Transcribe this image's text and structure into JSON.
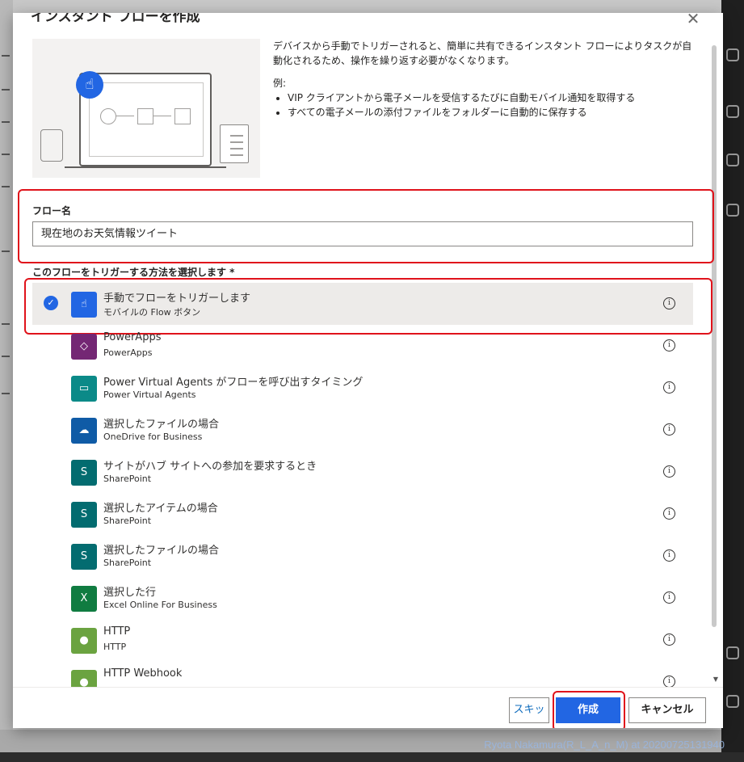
{
  "dialog": {
    "title": "インスタント フローを作成",
    "description": "デバイスから手動でトリガーされると、簡単に共有できるインスタント フローによりタスクが自動化されるため、操作を繰り返す必要がなくなります。",
    "example_label": "例:",
    "examples": [
      "VIP クライアントから電子メールを受信するたびに自動モバイル通知を取得する",
      "すべての電子メールの添付ファイルをフォルダーに自動的に保存する"
    ]
  },
  "flow_name": {
    "label": "フロー名",
    "value": "現在地のお天気情報ツイート"
  },
  "trigger_section": {
    "label": "このフローをトリガーする方法を選択します *"
  },
  "triggers": [
    {
      "name": "手動でフローをトリガーします",
      "sub": "モバイルの Flow ボタン",
      "color": "#2266e3",
      "icon": "☝",
      "selected": true
    },
    {
      "name": "PowerApps",
      "sub": "PowerApps",
      "color": "#742774",
      "icon": "◇"
    },
    {
      "name": "Power Virtual Agents がフローを呼び出すタイミング",
      "sub": "Power Virtual Agents",
      "color": "#0b8a88",
      "icon": "▭"
    },
    {
      "name": "選択したファイルの場合",
      "sub": "OneDrive for Business",
      "color": "#0f5ba6",
      "icon": "☁"
    },
    {
      "name": "サイトがハブ サイトへの参加を要求するとき",
      "sub": "SharePoint",
      "color": "#036c70",
      "icon": "S"
    },
    {
      "name": "選択したアイテムの場合",
      "sub": "SharePoint",
      "color": "#036c70",
      "icon": "S"
    },
    {
      "name": "選択したファイルの場合",
      "sub": "SharePoint",
      "color": "#036c70",
      "icon": "S"
    },
    {
      "name": "選択した行",
      "sub": "Excel Online For Business",
      "color": "#107c41",
      "icon": "X"
    },
    {
      "name": "HTTP",
      "sub": "HTTP",
      "color": "#6ba340",
      "icon": "●"
    },
    {
      "name": "HTTP Webhook",
      "sub": "",
      "color": "#6ba340",
      "icon": "●"
    }
  ],
  "footer": {
    "skip": "スキップ",
    "create": "作成",
    "cancel": "キャンセル"
  },
  "watermark": "Ryota Nakamura(R_L_A_n_M) at 20200725131940"
}
